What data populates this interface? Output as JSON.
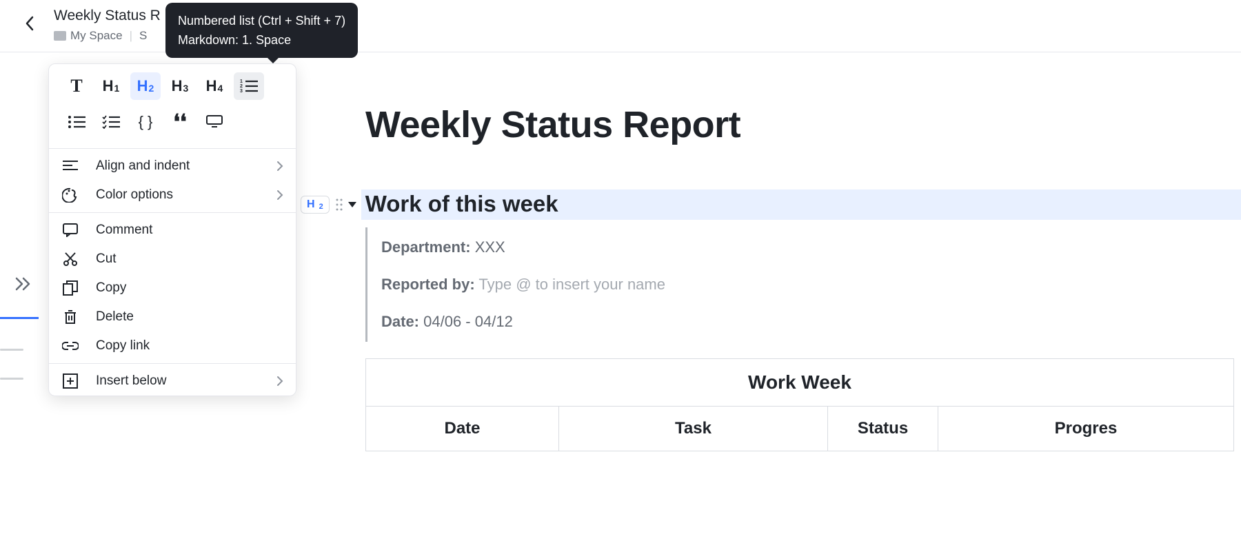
{
  "header": {
    "doc_title": "Weekly Status R",
    "breadcrumb_folder": "My Space",
    "breadcrumb_next": "S"
  },
  "tooltip": {
    "line1": "Numbered list (Ctrl + Shift + 7)",
    "line2": "Markdown: 1. Space"
  },
  "toolbar": {
    "t": "T",
    "h1": "H",
    "h1s": "1",
    "h2": "H",
    "h2s": "2",
    "h3": "H",
    "h3s": "3",
    "h4": "H",
    "h4s": "4"
  },
  "menu": {
    "align": "Align and indent",
    "color": "Color options",
    "comment": "Comment",
    "cut": "Cut",
    "copy": "Copy",
    "delete": "Delete",
    "copylink": "Copy link",
    "insert": "Insert below"
  },
  "doc": {
    "title": "Weekly Status Report",
    "h2_badge": "H",
    "h2_badge_s": "2",
    "h2": "Work of this week",
    "dept_label": "Department:",
    "dept_val": "XXX",
    "reported_label": "Reported by:",
    "reported_placeholder": "Type @ to insert your name",
    "date_label": "Date:",
    "date_val": "04/06 - 04/12"
  },
  "table": {
    "caption": "Work Week",
    "cols": {
      "date": "Date",
      "task": "Task",
      "status": "Status",
      "progress": "Progres"
    }
  }
}
